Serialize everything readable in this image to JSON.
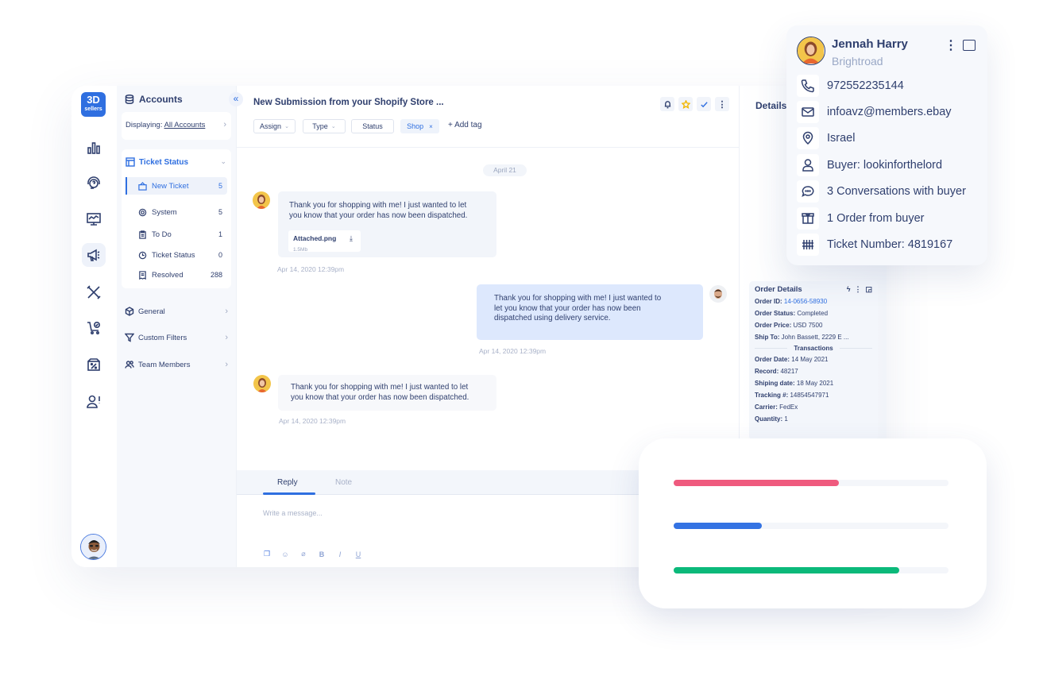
{
  "app": {
    "logo": {
      "line1": "3D",
      "line2": "sellers"
    },
    "rail": [
      {
        "name": "analytics",
        "icon": "bar-chart-icon"
      },
      {
        "name": "support",
        "icon": "headset-icon"
      },
      {
        "name": "monitor",
        "icon": "monitor-chart-icon"
      },
      {
        "name": "marketing",
        "icon": "megaphone-icon",
        "active": true
      },
      {
        "name": "tools",
        "icon": "tools-icon"
      },
      {
        "name": "cart",
        "icon": "cart-check-icon"
      },
      {
        "name": "discounts",
        "icon": "discount-box-icon"
      },
      {
        "name": "user-alert",
        "icon": "user-alert-icon"
      }
    ]
  },
  "nav": {
    "title": "Accounts",
    "collapse_glyph": "«",
    "displaying_label": "Displaying:",
    "displaying_value": "All Accounts",
    "ticket_status": {
      "title": "Ticket Status",
      "items": [
        {
          "label": "New Ticket",
          "count": "5",
          "active": true
        },
        {
          "label": "System",
          "count": "5"
        },
        {
          "label": "To Do",
          "count": "1"
        },
        {
          "label": "Ticket Status",
          "count": "0"
        },
        {
          "label": "Resolved",
          "count": "288"
        }
      ]
    },
    "links": [
      {
        "label": "General"
      },
      {
        "label": "Custom Filters"
      },
      {
        "label": "Team Members"
      }
    ]
  },
  "ticket": {
    "title": "New Submission from your Shopify Store ...",
    "chips": {
      "assign": "Assign",
      "type": "Type",
      "status": "Status",
      "shop": "Shop",
      "shop_remove": "×",
      "add_tag": "+ Add tag"
    },
    "date_divider": "April 21",
    "messages": [
      {
        "direction": "in",
        "text_line1": "Thank you for shopping with me! I just wanted to let",
        "text_line2": "you know that your order has now been dispatched.",
        "attachment": {
          "name": "Attached.png",
          "size": "1.5Mb"
        },
        "time": "Apr 14, 2020 12:39pm"
      },
      {
        "direction": "out",
        "text_line1": "Thank you for shopping with me! I just wanted to",
        "text_line2": "let you know that your order has now been",
        "text_line3": "dispatched using  delivery service.",
        "time": "Apr 14, 2020 12:39pm"
      },
      {
        "direction": "in",
        "text_line1": "Thank you for shopping with me! I just wanted to let",
        "text_line2": "you know that your order has now been dispatched.",
        "time": "Apr 14, 2020 12:39pm"
      }
    ],
    "composer": {
      "tabs": [
        "Reply",
        "Note"
      ],
      "active_tab": "Reply",
      "placeholder": "Write a message...",
      "toolbar": {
        "bold": "B",
        "italic": "I",
        "underline": "U"
      }
    }
  },
  "details": {
    "title": "Details",
    "order": {
      "title": "Order Details",
      "rows": [
        {
          "label": "Order ID:",
          "value": "14-0656-58930",
          "link": true
        },
        {
          "label": "Order Status:",
          "value": "Completed"
        },
        {
          "label": "Order Price:",
          "value": "USD 7500"
        },
        {
          "label": "Ship To:",
          "value": "John Bassett, 2229 E ..."
        }
      ],
      "transactions_label": "Transactions",
      "transactions": [
        {
          "label": "Order Date:",
          "value": "14 May 2021"
        },
        {
          "label": "Record:",
          "value": "48217"
        },
        {
          "label": "Shiping date:",
          "value": "18 May 2021"
        },
        {
          "label": "Tracking #:",
          "value": "14854547971"
        },
        {
          "label": "Carrier:",
          "value": "FedEx"
        },
        {
          "label": "Quantity:",
          "value": "1"
        }
      ]
    }
  },
  "contact": {
    "name": "Jennah Harry",
    "company": "Brightroad",
    "rows": [
      {
        "icon": "phone-icon",
        "text": "972552235144"
      },
      {
        "icon": "mail-icon",
        "text": "infoavz@members.ebay"
      },
      {
        "icon": "location-icon",
        "text": "Israel"
      },
      {
        "icon": "user-icon",
        "text": "Buyer: lookinforthelord"
      },
      {
        "icon": "chat-icon",
        "text": "3 Conversations with buyer"
      },
      {
        "icon": "box-icon",
        "text": "1 Order from buyer"
      },
      {
        "icon": "tally-icon",
        "text": "Ticket Number: 4819167"
      }
    ]
  },
  "progress": {
    "bars": [
      {
        "name": "red",
        "percent": 60,
        "color": "#ef5a7e"
      },
      {
        "name": "blue",
        "percent": 32,
        "color": "#3473e3"
      },
      {
        "name": "green",
        "percent": 82,
        "color": "#0bb97a"
      }
    ]
  },
  "colors": {
    "accent": "#2f6fe0",
    "text": "#2f3f6e",
    "muted": "#a8b1c8",
    "out_bubble": "#dde8fd"
  }
}
